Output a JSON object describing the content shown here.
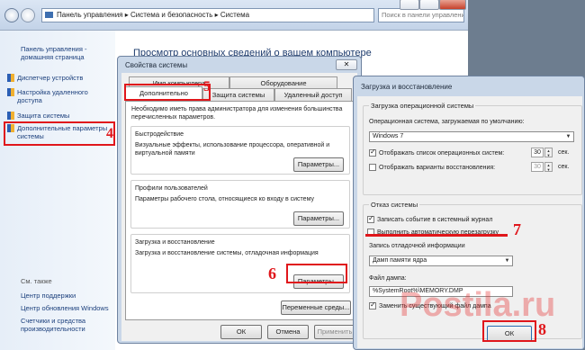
{
  "control_panel": {
    "breadcrumb": [
      "Панель управления",
      "Система и безопасность",
      "Система"
    ],
    "search_placeholder": "Поиск в панели управления",
    "main_heading": "Просмотр основных сведений о вашем компьютере",
    "sidebar": {
      "home": "Панель управления - домашняя страница",
      "links": [
        "Диспетчер устройств",
        "Настройка удаленного доступа",
        "Защита системы",
        "Дополнительные параметры системы"
      ],
      "see_also_title": "См. также",
      "see_also": [
        "Центр поддержки",
        "Центр обновления Windows",
        "Счетчики и средства производительности"
      ]
    }
  },
  "system_properties": {
    "title": "Свойства системы",
    "tabs_top": [
      "Имя компьютера",
      "Оборудование"
    ],
    "tabs_bottom": [
      "Дополнительно",
      "Защита системы",
      "Удаленный доступ"
    ],
    "admin_note": "Необходимо иметь права администратора для изменения большинства перечисленных параметров.",
    "performance": {
      "title": "Быстродействие",
      "text": "Визуальные эффекты, использование процессора, оперативной и виртуальной памяти",
      "button": "Параметры..."
    },
    "profiles": {
      "title": "Профили пользователей",
      "text": "Параметры рабочего стола, относящиеся ко входу в систему",
      "button": "Параметры..."
    },
    "startup": {
      "title": "Загрузка и восстановление",
      "text": "Загрузка и восстановление системы, отладочная информация",
      "button": "Параметры..."
    },
    "env_button": "Переменные среды...",
    "ok": "ОК",
    "cancel": "Отмена",
    "apply": "Применить"
  },
  "startup_recovery": {
    "title": "Загрузка и восстановление",
    "boot_group": "Загрузка операционной системы",
    "default_os_label": "Операционная система, загружаемая по умолчанию:",
    "default_os_value": "Windows 7",
    "show_list_label": "Отображать список операционных систем:",
    "show_list_value": "30",
    "show_recovery_label": "Отображать варианты восстановления:",
    "show_recovery_value": "30",
    "sec": "сек.",
    "failure_group": "Отказ системы",
    "write_log": "Записать событие в системный журнал",
    "auto_restart": "Выполнить автоматическую перезагрузку",
    "debug_info_group": "Запись отладочной информации",
    "debug_type": "Дамп памяти ядра",
    "dump_file_label": "Файл дампа:",
    "dump_file_value": "%SystemRoot%\\MEMORY.DMP",
    "overwrite": "Заменить существующий файл дампа",
    "ok": "ОК"
  },
  "annotations": [
    "4",
    "5",
    "6",
    "7",
    "8"
  ],
  "watermark": "Postila.ru"
}
